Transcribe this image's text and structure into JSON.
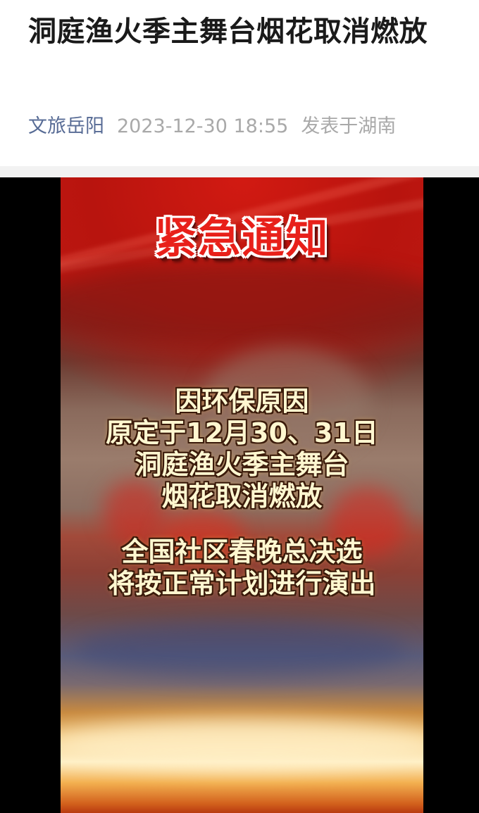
{
  "article": {
    "title": "洞庭渔火季主舞台烟花取消燃放",
    "author": "文旅岳阳",
    "datetime": "2023-12-30 18:55",
    "location": "发表于湖南"
  },
  "video": {
    "headline": "紧急通知",
    "notice_lines_1": [
      "因环保原因",
      "原定于12月30、31日",
      "洞庭渔火季主舞台",
      "烟花取消燃放"
    ],
    "notice_lines_2": [
      "全国社区春晚总决选",
      "将按正常计划进行演出"
    ]
  }
}
